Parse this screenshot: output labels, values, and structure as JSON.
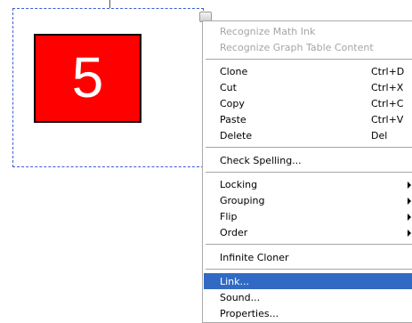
{
  "canvas": {
    "number": "5"
  },
  "menu": {
    "items": [
      {
        "label": "Recognize Math Ink",
        "shortcut": "",
        "submenu": false,
        "disabled": true,
        "highlighted": false
      },
      {
        "label": "Recognize Graph Table Content",
        "shortcut": "",
        "submenu": false,
        "disabled": true,
        "highlighted": false
      },
      {
        "label": "Clone",
        "shortcut": "Ctrl+D",
        "submenu": false,
        "disabled": false,
        "highlighted": false
      },
      {
        "label": "Cut",
        "shortcut": "Ctrl+X",
        "submenu": false,
        "disabled": false,
        "highlighted": false
      },
      {
        "label": "Copy",
        "shortcut": "Ctrl+C",
        "submenu": false,
        "disabled": false,
        "highlighted": false
      },
      {
        "label": "Paste",
        "shortcut": "Ctrl+V",
        "submenu": false,
        "disabled": false,
        "highlighted": false
      },
      {
        "label": "Delete",
        "shortcut": "Del",
        "submenu": false,
        "disabled": false,
        "highlighted": false
      },
      {
        "label": "Check Spelling...",
        "shortcut": "",
        "submenu": false,
        "disabled": false,
        "highlighted": false
      },
      {
        "label": "Locking",
        "shortcut": "",
        "submenu": true,
        "disabled": false,
        "highlighted": false
      },
      {
        "label": "Grouping",
        "shortcut": "",
        "submenu": true,
        "disabled": false,
        "highlighted": false
      },
      {
        "label": "Flip",
        "shortcut": "",
        "submenu": true,
        "disabled": false,
        "highlighted": false
      },
      {
        "label": "Order",
        "shortcut": "",
        "submenu": true,
        "disabled": false,
        "highlighted": false
      },
      {
        "label": "Infinite Cloner",
        "shortcut": "",
        "submenu": false,
        "disabled": false,
        "highlighted": false
      },
      {
        "label": "Link...",
        "shortcut": "",
        "submenu": false,
        "disabled": false,
        "highlighted": true
      },
      {
        "label": "Sound...",
        "shortcut": "",
        "submenu": false,
        "disabled": false,
        "highlighted": false
      },
      {
        "label": "Properties...",
        "shortcut": "",
        "submenu": false,
        "disabled": false,
        "highlighted": false
      }
    ]
  },
  "colors": {
    "card_fill": "#ff0000",
    "card_border": "#000000",
    "number_text": "#ffffff",
    "selection_border": "#3a5bd6",
    "menu_highlight": "#316ac5",
    "disabled_text": "#a5a5a5"
  }
}
